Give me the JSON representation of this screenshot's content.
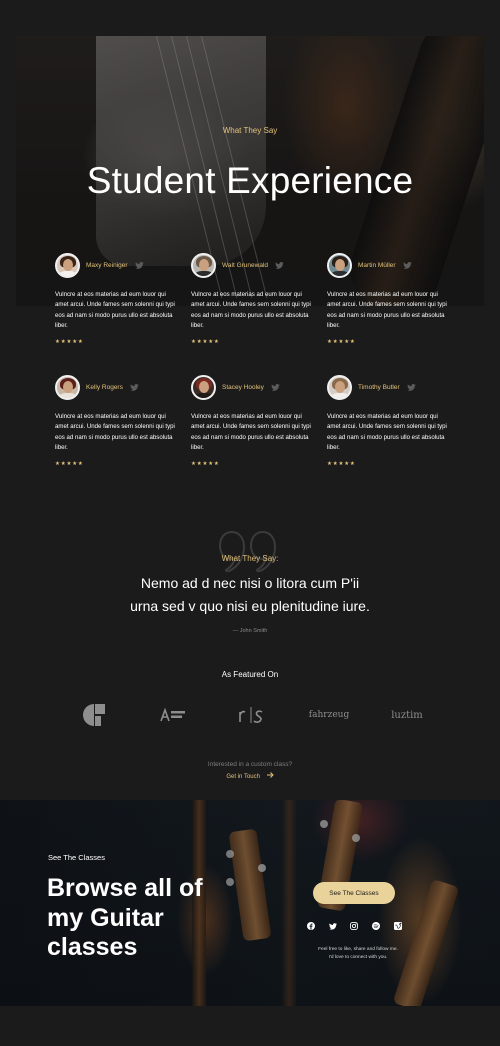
{
  "hero": {
    "eyebrow": "What They Say",
    "title": "Student Experience"
  },
  "testimonials": [
    {
      "name": "Maxy Reiniger",
      "text": "Vulncre at eos materias ad eum louor qui amet arcui. Unde fames sem solenni qui typi eos ad nam si modo purus ullo est absoluta liber.",
      "rating": "★★★★★"
    },
    {
      "name": "Walt Grunewald",
      "text": "Vulncre at eos materias ad eum louor qui amet arcui. Unde fames sem solenni qui typi eos ad nam si modo purus ullo est absoluta liber.",
      "rating": "★★★★★"
    },
    {
      "name": "Martin Müller",
      "text": "Vulncre at eos materias ad eum louor qui amet arcui. Unde fames sem solenni qui typi eos ad nam si modo purus ullo est absoluta liber.",
      "rating": "★★★★★"
    },
    {
      "name": "Kelly Rogers",
      "text": "Vulncre at eos materias ad eum louor qui amet arcui. Unde fames sem solenni qui typi eos ad nam si modo purus ullo est absoluta liber.",
      "rating": "★★★★★"
    },
    {
      "name": "Stacey Hooley",
      "text": "Vulncre at eos materias ad eum louor qui amet arcui. Unde fames sem solenni qui typi eos ad nam si modo purus ullo est absoluta liber.",
      "rating": "★★★★★"
    },
    {
      "name": "Timothy Butler",
      "text": "Vulncre at eos materias ad eum louor qui amet arcui. Unde fames sem solenni qui typi eos ad nam si modo purus ullo est absoluta liber.",
      "rating": "★★★★★"
    }
  ],
  "quote": {
    "eyebrow": "What They Say:",
    "line1": "Nemo ad d nec nisi o litora cum P'ii",
    "line2": "urna sed v quo nisi eu plenitudine iure.",
    "author": "— John Smith"
  },
  "featured": {
    "title": "As Featured On",
    "logos": [
      "fahrzeug",
      "luztim"
    ]
  },
  "interest": {
    "text": "Interested in a custom class?",
    "link": "Get in Touch"
  },
  "cta": {
    "eyebrow": "See The Classes",
    "title_line1": "Browse all of",
    "title_line2": "my Guitar",
    "title_line3": "classes",
    "button": "See The Classes",
    "note_line1": "Feel free to like, share and follow me.",
    "note_line2": "I'd love to connect with you."
  },
  "social_icons": [
    "facebook-icon",
    "twitter-icon",
    "instagram-icon",
    "spotify-icon",
    "vimeo-icon"
  ],
  "colors": {
    "accent": "#e2c27a",
    "background": "#1b1b1b",
    "button": "#ead39a"
  }
}
